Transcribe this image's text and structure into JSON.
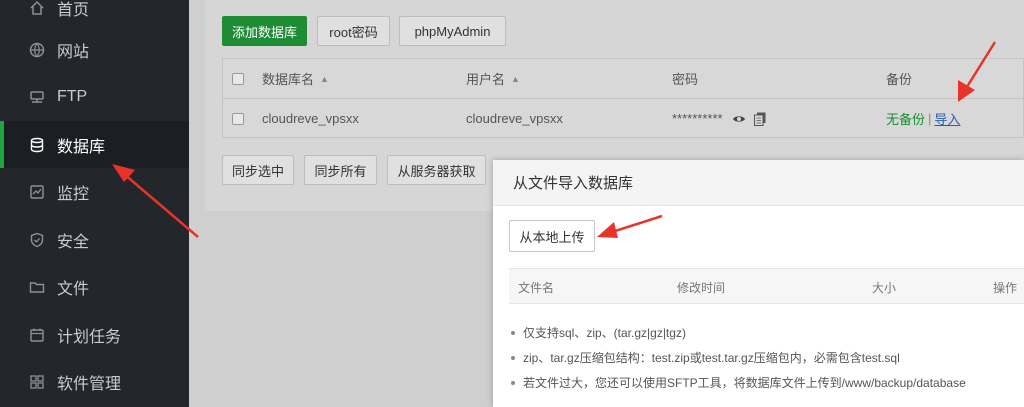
{
  "sidebar": {
    "items": [
      {
        "label": "首页",
        "icon": "home-icon"
      },
      {
        "label": "网站",
        "icon": "globe-icon"
      },
      {
        "label": "FTP",
        "icon": "ftp-icon"
      },
      {
        "label": "数据库",
        "icon": "database-icon"
      },
      {
        "label": "监控",
        "icon": "monitor-icon"
      },
      {
        "label": "安全",
        "icon": "shield-icon"
      },
      {
        "label": "文件",
        "icon": "folder-icon"
      },
      {
        "label": "计划任务",
        "icon": "calendar-icon"
      },
      {
        "label": "软件管理",
        "icon": "grid-icon"
      }
    ],
    "active_index": 3,
    "active_color": "#20a53a"
  },
  "toolbar": {
    "add_db": "添加数据库",
    "root_pwd": "root密码",
    "phpmyadmin": "phpMyAdmin"
  },
  "table": {
    "headers": {
      "name": "数据库名",
      "user": "用户名",
      "password": "密码",
      "backup": "备份"
    },
    "rows": [
      {
        "name": "cloudreve_vpsxx",
        "user": "cloudreve_vpsxx",
        "password": "**********",
        "backup_status": "无备份",
        "import": "导入"
      }
    ]
  },
  "actions": {
    "sync_selected": "同步选中",
    "sync_all": "同步所有",
    "fetch_server": "从服务器获取"
  },
  "modal": {
    "title": "从文件导入数据库",
    "upload_local": "从本地上传",
    "columns": {
      "filename": "文件名",
      "mtime": "修改时间",
      "size": "大小",
      "op": "操作"
    },
    "tips": [
      "仅支持sql、zip、(tar.gz|gz|tgz)",
      "zip、tar.gz压缩包结构：test.zip或test.tar.gz压缩包内，必需包含test.sql",
      "若文件过大，您还可以使用SFTP工具，将数据库文件上传到/www/backup/database"
    ]
  },
  "colors": {
    "brand_green": "#20a53a",
    "arrow_red": "#e8332a",
    "sidebar_bg": "#23262b"
  }
}
